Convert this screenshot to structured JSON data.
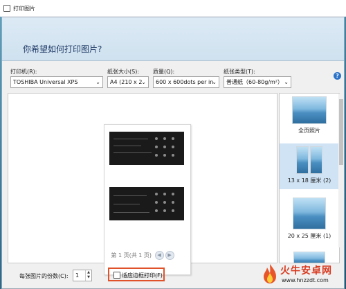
{
  "window": {
    "title": "打印图片"
  },
  "header": {
    "question": "你希望如何打印图片?"
  },
  "options": {
    "printer": {
      "label": "打印机(R):",
      "value": "TOSHIBA Universal XPS"
    },
    "paper_size": {
      "label": "纸张大小(S):",
      "value": "A4 (210 x 2"
    },
    "quality": {
      "label": "质量(Q):",
      "value": "600 x 600dots per in"
    },
    "paper_type": {
      "label": "纸张类型(T):",
      "value": "普通纸（60-80g/m²）"
    }
  },
  "preview": {
    "page_info": "第 1 页(共 1 页)"
  },
  "layouts": [
    {
      "caption": "全页照片"
    },
    {
      "caption": "13 x 18 厘米 (2)"
    },
    {
      "caption": "20 x 25 厘米 (1)"
    }
  ],
  "footer": {
    "copies_label": "每张图片的份数(C):",
    "copies_value": "1",
    "fit_label": "适应边框打印(F)",
    "fit_checked": false
  },
  "watermark": {
    "brand": "火牛安卓网",
    "url": "www.hnzzdt.com"
  },
  "colors": {
    "accent": "#2a73c9",
    "highlight_box": "#e0522a",
    "banner_text": "#1f3a66"
  }
}
